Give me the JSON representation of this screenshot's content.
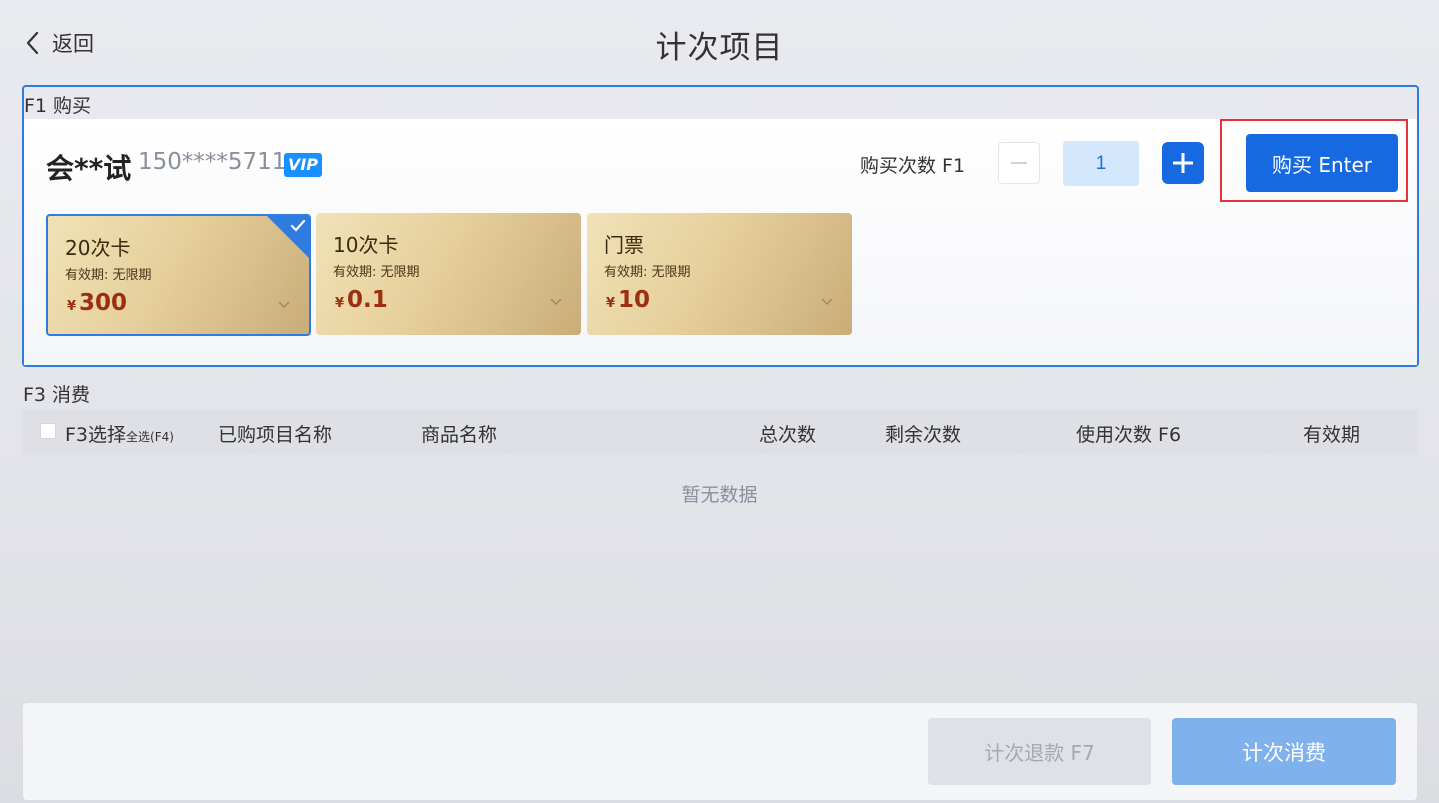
{
  "header": {
    "back_label": "返回",
    "title": "计次项目"
  },
  "buy": {
    "section_label": "F1 购买",
    "member": {
      "name": "会**试",
      "phone": "150****5711",
      "badge": "VIP",
      "badge_color": "#1890ff"
    },
    "quantity_label": "购买次数 F1",
    "quantity_value": "1",
    "buy_button_label": "购买 Enter",
    "accent_color": "#1669e0",
    "highlight_color": "#e8313a",
    "cards": [
      {
        "name": "20次卡",
        "validity": "有效期: 无限期",
        "currency": "¥",
        "price": "300",
        "selected": true
      },
      {
        "name": "10次卡",
        "validity": "有效期: 无限期",
        "currency": "¥",
        "price": "0.1",
        "selected": false
      },
      {
        "name": "门票",
        "validity": "有效期: 无限期",
        "currency": "¥",
        "price": "10",
        "selected": false
      }
    ]
  },
  "consume": {
    "section_label": "F3 消费",
    "columns": {
      "select": "F3选择",
      "select_all": "全选(F4)",
      "item_name": "已购项目名称",
      "product_name": "商品名称",
      "total": "总次数",
      "remaining": "剩余次数",
      "use_count": "使用次数 F6",
      "validity": "有效期"
    },
    "rows": [],
    "empty_text": "暂无数据"
  },
  "footer": {
    "refund_label": "计次退款 F7",
    "consume_label": "计次消费"
  }
}
